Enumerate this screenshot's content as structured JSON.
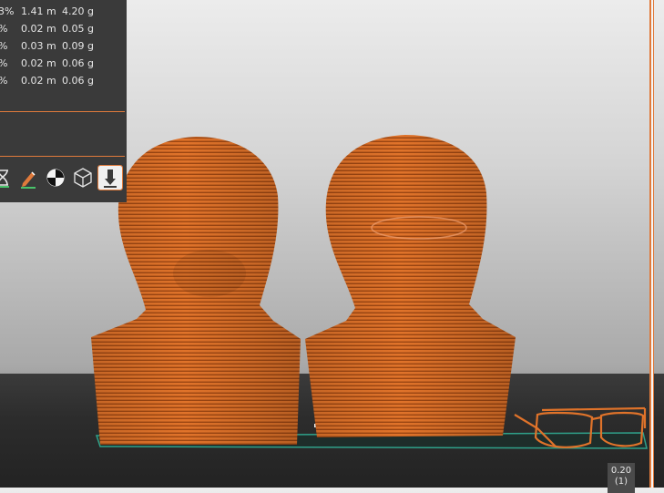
{
  "stats": {
    "rows": [
      {
        "percent": "3%",
        "length": "1.41 m",
        "weight": "4.20 g"
      },
      {
        "percent": "%",
        "length": "0.02 m",
        "weight": "0.05 g"
      },
      {
        "percent": "%",
        "length": "0.03 m",
        "weight": "0.09 g"
      },
      {
        "percent": "%",
        "length": "0.02 m",
        "weight": "0.06 g"
      },
      {
        "percent": "%",
        "length": "0.02 m",
        "weight": "0.06 g"
      }
    ]
  },
  "toolbar": {
    "items": [
      {
        "icon": "hourglass-icon",
        "active": false
      },
      {
        "icon": "pencil-icon",
        "active": false
      },
      {
        "icon": "center-icon",
        "active": false
      },
      {
        "icon": "cube-icon",
        "active": false
      },
      {
        "icon": "drop-to-bed-icon",
        "active": true
      }
    ]
  },
  "layer_slider": {
    "height_value": "0.20",
    "layer_index": "(1)"
  },
  "colors": {
    "accent": "#e07a3b",
    "model": "#e0732a",
    "panel": "#3a3a3a",
    "bed_outline": "#2fa18a"
  }
}
